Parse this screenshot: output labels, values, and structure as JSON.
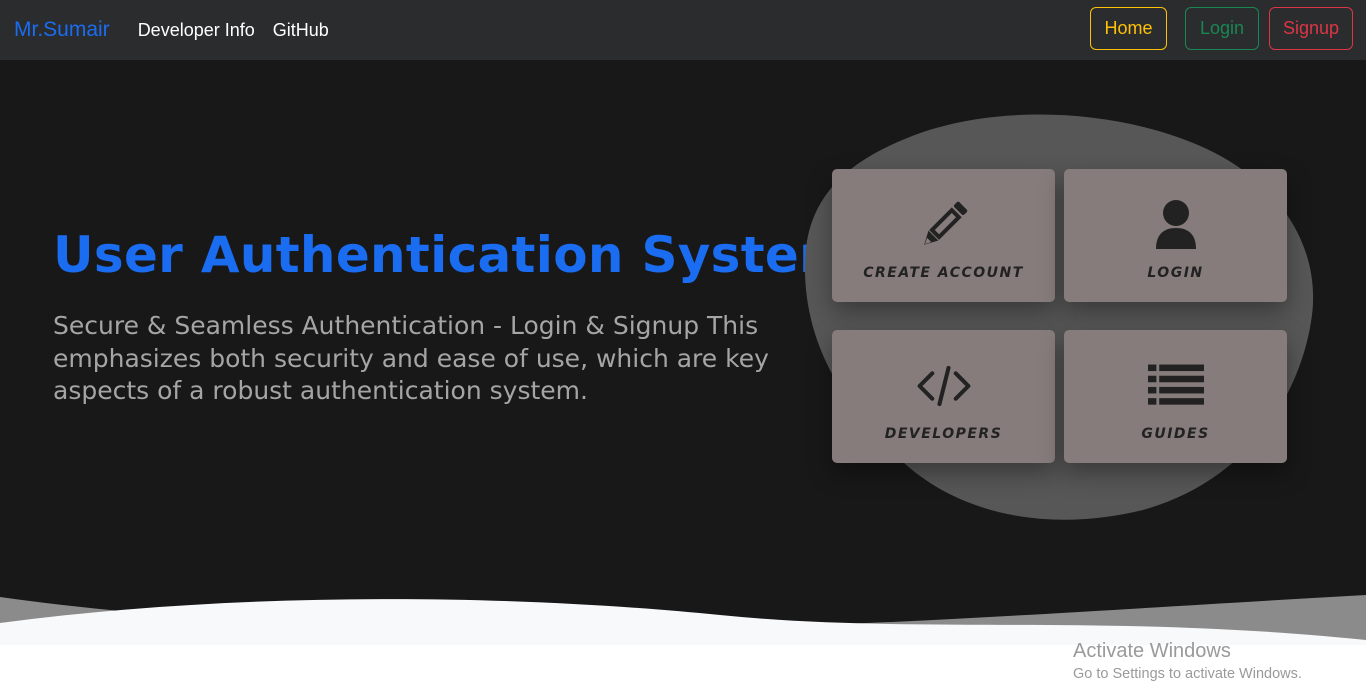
{
  "navbar": {
    "brand": "Mr.Sumair",
    "links": [
      "Developer Info",
      "GitHub"
    ],
    "buttons": {
      "home": "Home",
      "login": "Login",
      "signup": "Signup"
    }
  },
  "hero": {
    "title": "User Authentication System",
    "subtitle": "Secure & Seamless Authentication - Login & Signup This emphasizes both security and ease of use, which are key aspects of a robust authentication system."
  },
  "cards": [
    {
      "label": "CREATE ACCOUNT",
      "icon": "pencil-icon"
    },
    {
      "label": "LOGIN",
      "icon": "user-icon"
    },
    {
      "label": "DEVELOPERS",
      "icon": "code-icon"
    },
    {
      "label": "GUIDES",
      "icon": "list-icon"
    }
  ],
  "watermark": {
    "title": "Activate Windows",
    "subtitle": "Go to Settings to activate Windows."
  },
  "colors": {
    "brand": "#1a6cf0",
    "navbar_bg": "#2b2c2e",
    "hero_bg": "#181819",
    "card_bg": "#877c7c",
    "home": "#ffc107",
    "login": "#198754",
    "signup": "#dc3545"
  }
}
